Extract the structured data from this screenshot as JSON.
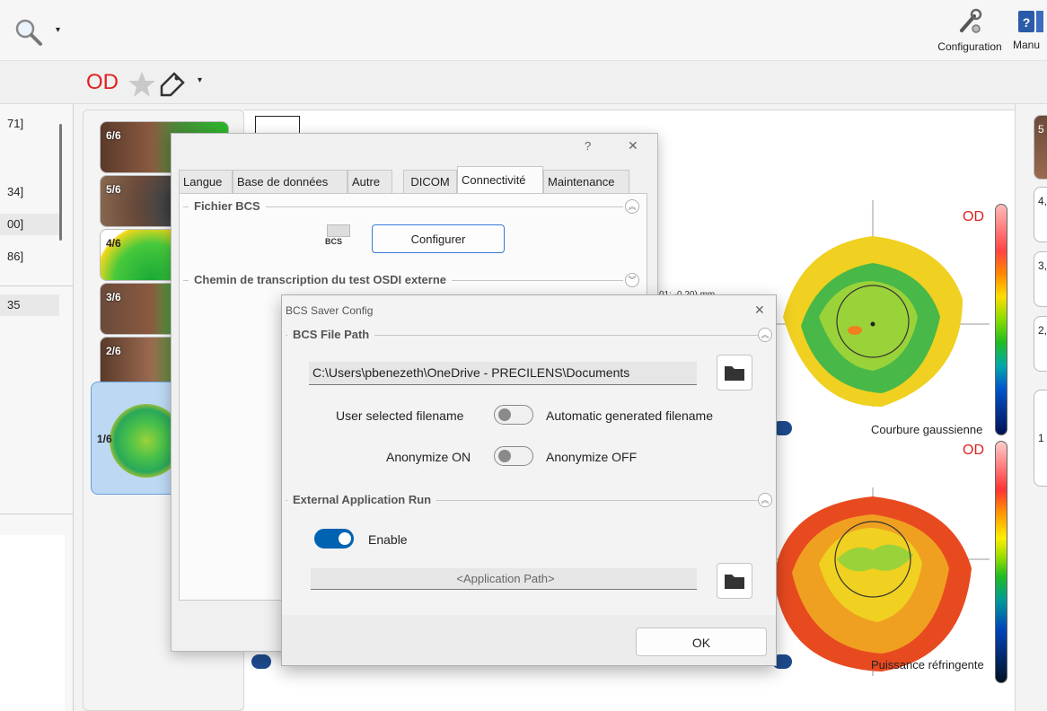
{
  "toolbar": {
    "configuration_label": "Configuration",
    "manual_label": "Manu"
  },
  "eye_bar": {
    "eye": "OD"
  },
  "left_list": {
    "rows": [
      "71]",
      "34]",
      "00]",
      "86]",
      "35"
    ]
  },
  "thumbnails": {
    "items": [
      "6/6",
      "5/6",
      "4/6",
      "3/6",
      "2/6",
      "1/6"
    ]
  },
  "right_list": {
    "items": [
      "5",
      "4,",
      "3,",
      "2,",
      "1"
    ]
  },
  "config_dialog": {
    "help": "?",
    "close": "✕",
    "tabs": [
      "Langue",
      "Base de données",
      "Autre",
      "DICOM",
      "Connectivité",
      "Maintenance"
    ],
    "active_tab": "Connectivité",
    "section_bcs": "Fichier BCS",
    "bcs_icon_text": "BCS",
    "configure_button": "Configurer",
    "section_osdi": "Chemin de transcription du test OSDI externe"
  },
  "bcs_dialog": {
    "title": "BCS Saver Config",
    "close": "✕",
    "section_path": "BCS File Path",
    "path_value": "C:\\Users\\pbenezeth\\OneDrive - PRECILENS\\Documents",
    "filename_left": "User selected filename",
    "filename_right": "Automatic generated filename",
    "filename_toggle_on": false,
    "anon_left": "Anonymize ON",
    "anon_right": "Anonymize OFF",
    "anon_toggle_on": false,
    "section_app": "External Application Run",
    "enable_label": "Enable",
    "enable_toggle_on": true,
    "app_path_placeholder": "<Application Path>",
    "ok_button": "OK"
  },
  "maps": {
    "top_eye": "OD",
    "top_label": "Courbure gaussienne",
    "bottom_eye": "OD",
    "bottom_label": "Puissance réfringente",
    "coord_text": "01; -0.20) mm"
  },
  "colors": {
    "accent": "#0063b1",
    "od_red": "#e02020"
  }
}
